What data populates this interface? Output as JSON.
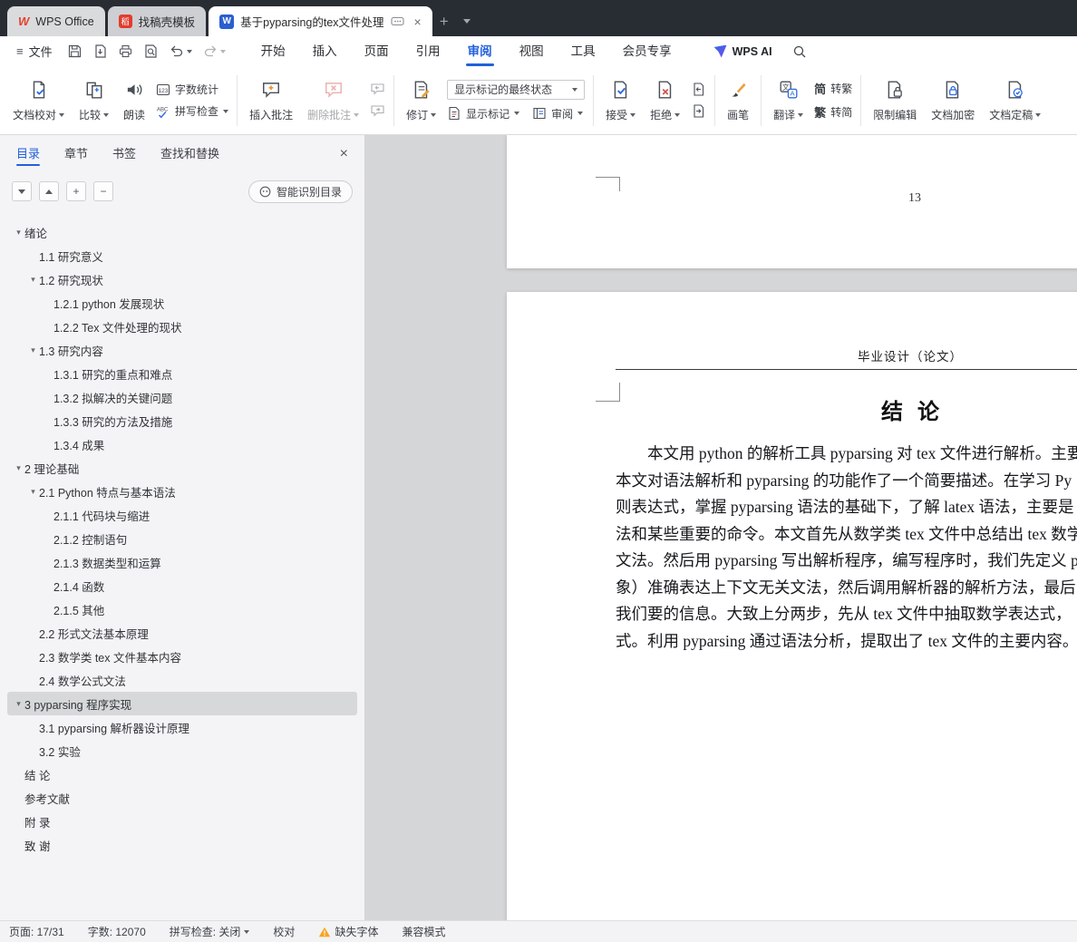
{
  "titlebar": {
    "app_tab": "WPS Office",
    "template_tab": "找稿壳模板",
    "doc_tab": "基于pyparsing的tex文件处理"
  },
  "menubar": {
    "file": "文件",
    "tabs": [
      {
        "label": "开始"
      },
      {
        "label": "插入"
      },
      {
        "label": "页面"
      },
      {
        "label": "引用"
      },
      {
        "label": "审阅",
        "active": true
      },
      {
        "label": "视图"
      },
      {
        "label": "工具"
      },
      {
        "label": "会员专享"
      }
    ],
    "wps_ai": "WPS AI"
  },
  "ribbon": {
    "doc_proof": "文档校对",
    "compare": "比较",
    "read_aloud": "朗读",
    "word_count": "字数统计",
    "spell_check": "拼写检查",
    "insert_comment": "插入批注",
    "delete_comment": "删除批注",
    "track_changes": "修订",
    "markup_state": "显示标记的最终状态",
    "show_markup": "显示标记",
    "review_pane": "审阅",
    "accept": "接受",
    "reject": "拒绝",
    "brush": "画笔",
    "translate": "翻译",
    "simp_prefix": "简",
    "to_trad": "转繁",
    "trad_prefix": "繁",
    "to_simp": "转简",
    "restrict_edit": "限制编辑",
    "encrypt": "文档加密",
    "finalize": "文档定稿"
  },
  "sidebar": {
    "tabs": [
      {
        "label": "目录",
        "active": true
      },
      {
        "label": "章节",
        "active": false
      },
      {
        "label": "书签",
        "active": false
      },
      {
        "label": "查找和替换",
        "active": false
      }
    ],
    "smart_toc": "智能识别目录",
    "items": [
      {
        "label": "绪论",
        "level": 0,
        "arrow": true
      },
      {
        "label": "1.1 研究意义",
        "level": 1
      },
      {
        "label": "1.2 研究现状",
        "level": 1,
        "arrow": true
      },
      {
        "label": "1.2.1 python 发展现状",
        "level": 2
      },
      {
        "label": "1.2.2 Tex 文件处理的现状",
        "level": 2
      },
      {
        "label": "1.3 研究内容",
        "level": 1,
        "arrow": true
      },
      {
        "label": "1.3.1 研究的重点和难点",
        "level": 2
      },
      {
        "label": "1.3.2 拟解决的关键问题",
        "level": 2
      },
      {
        "label": "1.3.3 研究的方法及措施",
        "level": 2
      },
      {
        "label": "1.3.4 成果",
        "level": 2
      },
      {
        "label": "2 理论基础",
        "level": 0,
        "arrow": true
      },
      {
        "label": "2.1 Python 特点与基本语法",
        "level": 1,
        "arrow": true
      },
      {
        "label": "2.1.1 代码块与缩进",
        "level": 2
      },
      {
        "label": "2.1.2 控制语句",
        "level": 2
      },
      {
        "label": "2.1.3 数据类型和运算",
        "level": 2
      },
      {
        "label": "2.1.4 函数",
        "level": 2
      },
      {
        "label": "2.1.5 其他",
        "level": 2
      },
      {
        "label": "2.2 形式文法基本原理",
        "level": 1
      },
      {
        "label": "2.3 数学类 tex 文件基本内容",
        "level": 1
      },
      {
        "label": "2.4 数学公式文法",
        "level": 1
      },
      {
        "label": "3 pyparsing 程序实现",
        "level": 0,
        "arrow": true,
        "selected": true
      },
      {
        "label": "3.1 pyparsing 解析器设计原理",
        "level": 1
      },
      {
        "label": "3.2 实验",
        "level": 1
      },
      {
        "label": "结 论",
        "level": 0
      },
      {
        "label": "参考文献",
        "level": 0
      },
      {
        "label": "附 录",
        "level": 0
      },
      {
        "label": "致 谢",
        "level": 0
      }
    ]
  },
  "document": {
    "prev_page_number": "13",
    "header": "毕业设计（论文）",
    "title": "结 论",
    "lines": [
      "　　本文用 python 的解析工具 pyparsing 对 tex 文件进行解析。主要",
      "本文对语法解析和 pyparsing 的功能作了一个简要描述。在学习 Py",
      "则表达式，掌握 pyparsing 语法的基础下，了解 latex 语法，主要是",
      "法和某些重要的命令。本文首先从数学类 tex 文件中总结出 tex 数学",
      "文法。然后用 pyparsing 写出解析程序，编写程序时，我们先定义 py",
      "象）准确表达上下文无关文法，然后调用解析器的解析方法，最后",
      "我们要的信息。大致上分两步，先从 tex 文件中抽取数学表达式，",
      "式。利用 pyparsing 通过语法分析，提取出了 tex 文件的主要内容。"
    ]
  },
  "statusbar": {
    "page": "页面: 17/31",
    "words": "字数: 12070",
    "spell": "拼写检查: 关闭",
    "proof": "校对",
    "missing_font": "缺失字体",
    "compat": "兼容模式"
  }
}
